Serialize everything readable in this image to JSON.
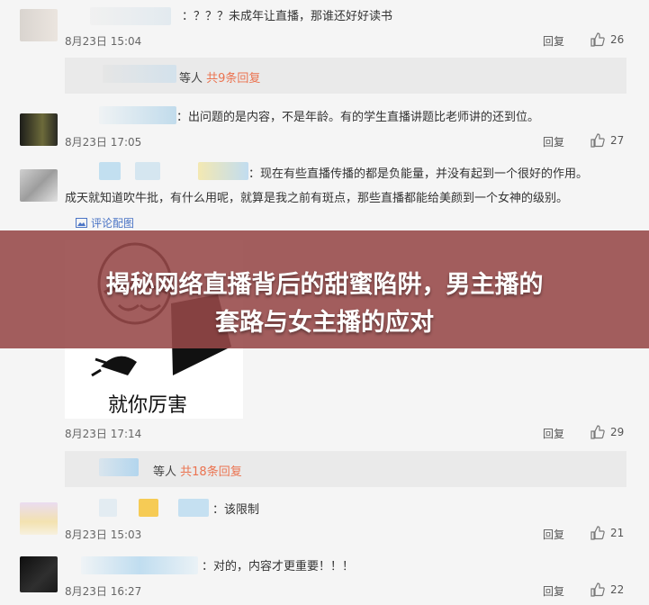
{
  "comments": [
    {
      "text": "：？？？未成年让直播，那谁还好好读书",
      "date": "8月23日 15:04",
      "reply": "回复",
      "likes": "26"
    },
    {
      "text": "：出问题的是内容，不是年龄。有的学生直播讲题比老师讲的还到位。",
      "date": "8月23日 17:05",
      "reply": "回复",
      "likes": "27"
    },
    {
      "text": "：现在有些直播传播的都是负能量，并没有起到一个很好的作用。",
      "text2": "成天就知道吹牛批，有什么用呢，就算是我之前有斑点，那些直播都能给美颜到一个女神的级别。",
      "pic_link": "评论配图",
      "meme_caption": "就你厉害",
      "date": "8月23日 17:14",
      "reply": "回复",
      "likes": "29"
    },
    {
      "text": "：该限制",
      "date": "8月23日 15:03",
      "reply": "回复",
      "likes": "21"
    },
    {
      "text": "：对的，内容才更重要！！！",
      "date": "8月23日 16:27",
      "reply": "回复",
      "likes": "22"
    }
  ],
  "subreplies": [
    {
      "prefix": "等人",
      "link": "共9条回复"
    },
    {
      "prefix": "等人",
      "link": "共18条回复"
    }
  ],
  "banner": {
    "line1": "揭秘网络直播背后的甜蜜陷阱，男主播的",
    "line2": "套路与女主播的应对"
  }
}
